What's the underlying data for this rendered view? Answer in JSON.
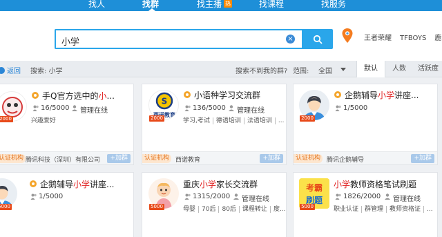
{
  "nav": {
    "items": [
      "找人",
      "找群",
      "找主播",
      "找课程",
      "找服务"
    ],
    "active_index": 1,
    "hot_badge": "热"
  },
  "search": {
    "query": "小学",
    "hot_words": [
      "王者荣耀",
      "TFBOYS",
      "鹿晗"
    ]
  },
  "filter": {
    "back": "返回",
    "search_label": "搜索: 小学",
    "not_found": "搜索不到我的群?",
    "scope_label": "范围:",
    "scope_value": "全国",
    "sort_tabs": [
      "默认",
      "人数",
      "活跃度"
    ],
    "active_sort": 0
  },
  "cards": [
    {
      "title_pre": "手Q官方选中的",
      "title_hl": "小",
      "title_post": "...",
      "members": "16/5000",
      "status": "管理在线",
      "tags": [
        "兴趣爱好"
      ],
      "cap": "2000",
      "verified": "认证机构",
      "org": "腾讯科技（深圳）有限公司",
      "join": "+加群"
    },
    {
      "title_pre": "小语种学习交流群",
      "title_hl": "",
      "title_post": "",
      "members": "136/5000",
      "status": "管理在线",
      "tags": [
        "学习,考试",
        "德语培训",
        "法语培训",
        "..."
      ],
      "cap": "2000",
      "verified": "认证机构",
      "org": "西诺教育",
      "join": "+加群",
      "avatar_text": "西诺教育"
    },
    {
      "title_pre": "企鹅辅导",
      "title_hl": "小学",
      "title_post": "讲座...",
      "members": "1/5000",
      "status": "",
      "tags": [],
      "cap": "2000",
      "verified": "认证机构",
      "org": "腾讯企鹅辅导",
      "join": "+加群"
    },
    {
      "title_pre": "企鹅辅导",
      "title_hl": "小学",
      "title_post": "讲座...",
      "members": "1/5000",
      "status": "",
      "tags": [],
      "cap": "5000"
    },
    {
      "title_pre": "重庆",
      "title_hl": "小学",
      "title_post": "家长交流群",
      "members": "1315/2000",
      "status": "管理在线",
      "tags": [
        "母婴",
        "70后",
        "80后",
        "课程转让",
        "度..."
      ],
      "cap": "5000"
    },
    {
      "title_pre": "",
      "title_hl": "小学",
      "title_post": "教师资格笔试刷题",
      "members": "1826/2000",
      "status": "管理在线",
      "tags": [
        "职业认证",
        "群管理",
        "教师资格证",
        "..."
      ],
      "cap": "5000",
      "avatar_text": [
        "考霸",
        "刷题"
      ]
    }
  ],
  "colors": {
    "nav_blue": "#1e8fd8",
    "search_blue": "#2aa6ea",
    "highlight_red": "#e02020",
    "cap_red": "#e84a1a",
    "verified_orange": "#e4751f"
  }
}
